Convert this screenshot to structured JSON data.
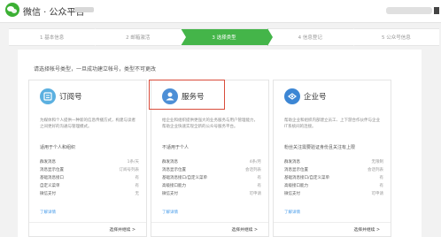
{
  "header": {
    "app_title": "微信 · 公众平台"
  },
  "steps": [
    {
      "label": "1 基本信息",
      "active": false
    },
    {
      "label": "2 邮箱激活",
      "active": false
    },
    {
      "label": "3 选择类型",
      "active": true
    },
    {
      "label": "4 信息登记",
      "active": false
    },
    {
      "label": "5 公众号信息",
      "active": false
    }
  ],
  "notice": "请选择帐号类型，一旦成功建立帐号，类型不可更改",
  "cards": [
    {
      "name": "订阅号",
      "icon": "subscription-icon",
      "color": "#5bb0e0",
      "desc": "为媒体和个人提供一种新的信息传播方式，构建与读者之间更好的沟通与管理模式。",
      "suited": "适用于个人和组织",
      "features": [
        {
          "label": "群发消息",
          "value": "1条/天"
        },
        {
          "label": "消息显示位置",
          "value": "订阅号列表"
        },
        {
          "label": "基础消息接口",
          "value": "有"
        },
        {
          "label": "自定义菜单",
          "value": "有"
        },
        {
          "label": "微信支付",
          "value": "无"
        }
      ],
      "more": "了解详情",
      "choose": "选择并继续 >"
    },
    {
      "name": "服务号",
      "icon": "service-account-icon",
      "color": "#4d8fd6",
      "desc": "给企业和组织提供更强大的业务服务与用户管理能力，帮助企业快速实现全新的公众号服务平台。",
      "suited": "不适用于个人",
      "features": [
        {
          "label": "群发消息",
          "value": "4条/月"
        },
        {
          "label": "消息显示位置",
          "value": "会话列表"
        },
        {
          "label": "基础消息接口/自定义菜单",
          "value": "有"
        },
        {
          "label": "高级接口能力",
          "value": "有"
        },
        {
          "label": "微信支付",
          "value": "可申请"
        }
      ],
      "more": "了解详情",
      "choose": "选择并继续 >"
    },
    {
      "name": "企业号",
      "icon": "enterprise-icon",
      "color": "#3c86d4",
      "desc": "帮助企业和组织内部建立员工、上下游合作伙伴与企业IT系统间的连接。",
      "suited": "粉丝关注需要验证身份且关注有上限",
      "features": [
        {
          "label": "群发消息",
          "value": "无限制"
        },
        {
          "label": "消息显示位置",
          "value": "会话列表"
        },
        {
          "label": "基础消息接口/自定义菜单",
          "value": "有"
        },
        {
          "label": "高级接口能力",
          "value": "有"
        },
        {
          "label": "微信支付",
          "value": "可申请"
        }
      ],
      "more": "了解详情",
      "choose": "选择并继续 >"
    }
  ]
}
